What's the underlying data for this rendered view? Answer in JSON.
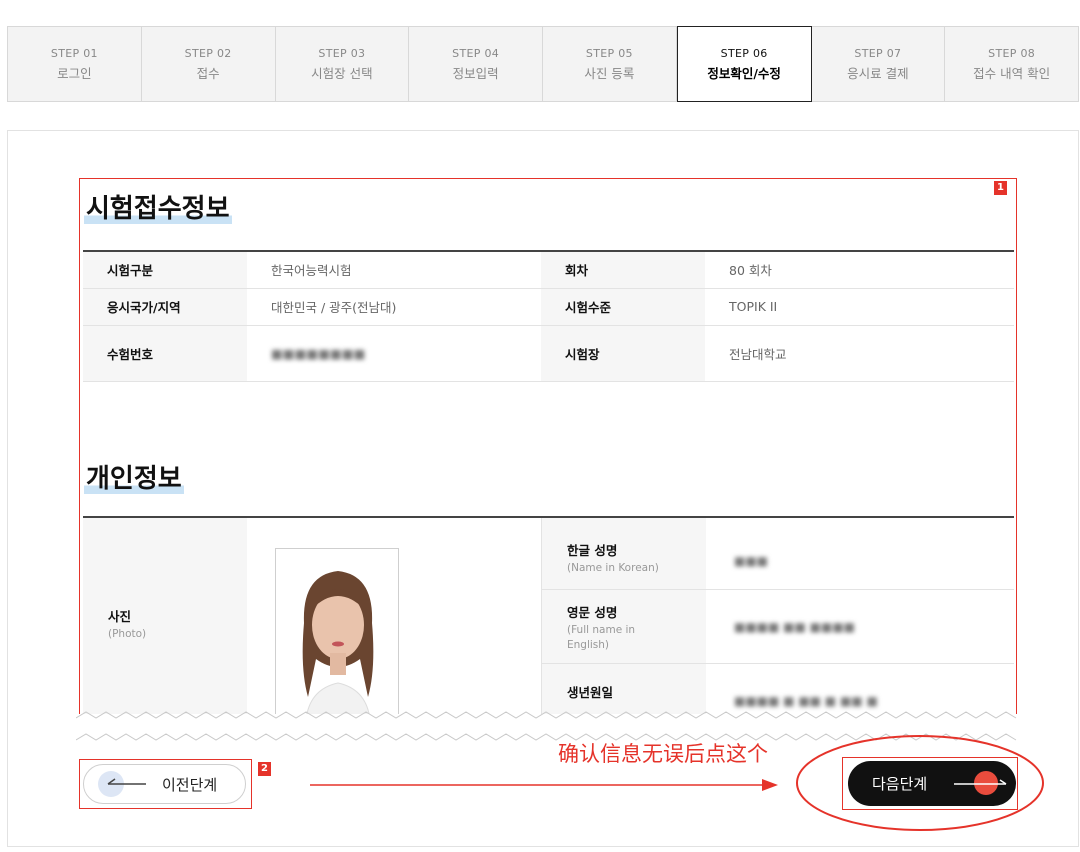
{
  "steps": [
    {
      "num": "STEP 01",
      "label": "로그인"
    },
    {
      "num": "STEP 02",
      "label": "접수"
    },
    {
      "num": "STEP 03",
      "label": "시험장 선택"
    },
    {
      "num": "STEP 04",
      "label": "정보입력"
    },
    {
      "num": "STEP 05",
      "label": "사진 등록"
    },
    {
      "num": "STEP 06",
      "label": "정보확인/수정"
    },
    {
      "num": "STEP 07",
      "label": "응시료 결제"
    },
    {
      "num": "STEP 08",
      "label": "접수 내역 확인"
    }
  ],
  "exam_section": {
    "title": "시험접수정보",
    "rows": [
      {
        "label1": "시험구분",
        "value1": "한국어능력시험",
        "label2": "회차",
        "value2": "80 회차"
      },
      {
        "label1": "응시국가/지역",
        "value1": "대한민국 / 광주(전남대)",
        "label2": "시험수준",
        "value2": "TOPIK II"
      },
      {
        "label1": "수험번호",
        "value1": "■■■■■■■■",
        "label2": "시험장",
        "value2": "전남대학교"
      }
    ]
  },
  "personal_section": {
    "title": "개인정보",
    "photo_label": "사진",
    "photo_sub": "(Photo)",
    "korean_name_label": "한글 성명",
    "korean_name_sub": "(Name in Korean)",
    "korean_name_value": "■■■",
    "english_name_label": "영문 성명",
    "english_name_sub": "(Full name in English)",
    "english_name_value": "■■■■ ■■ ■■■■",
    "birth_label": "생년원일",
    "birth_value": "■■■■ ■ ■■ ■ ■■ ■"
  },
  "buttons": {
    "prev": "이전단계",
    "next": "다음단계"
  },
  "annotations": {
    "badge1": "1",
    "badge2": "2",
    "note": "确认信息无误后点这个"
  },
  "colors": {
    "annotation_red": "#e5332a",
    "next_button_bg": "#111111",
    "next_button_dot": "#e94c3d",
    "title_highlight": "#c9e2f5"
  }
}
